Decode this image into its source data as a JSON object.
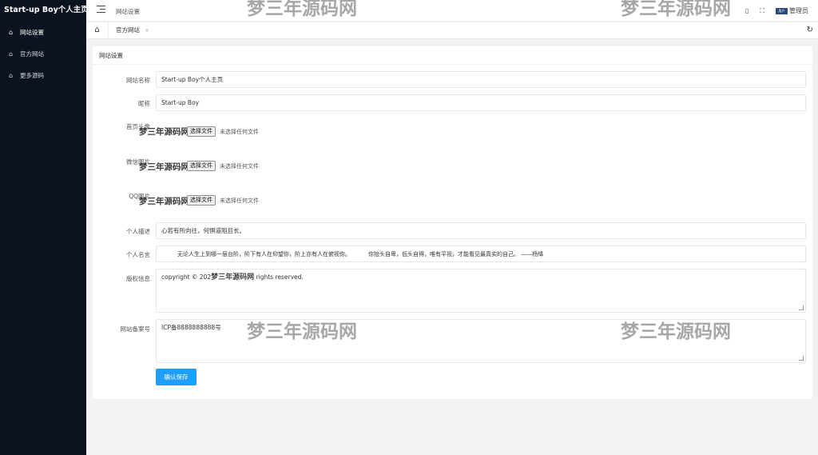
{
  "sidebar": {
    "logo": "Start-up Boy个人主页",
    "items": [
      {
        "label": "网站设置",
        "icon": "home-icon"
      },
      {
        "label": "官方网站",
        "icon": "home-icon"
      },
      {
        "label": "更多源码",
        "icon": "home-icon"
      }
    ]
  },
  "header": {
    "breadcrumb": "网站设置",
    "user_label": "管理员",
    "avatar_text": "用户"
  },
  "tabs": [
    {
      "label": "官方网站",
      "close": "×"
    }
  ],
  "form": {
    "card_title": "网站设置",
    "site_name_label": "网站名称",
    "site_name_value": "Start-up Boy个人主页",
    "nickname_label": "昵称",
    "nickname_value": "Start-up Boy",
    "avatar_label": "首页头像",
    "wechat_label": "微信图片",
    "qq_label": "QQ图片",
    "file_button": "选择文件",
    "file_status": "未选择任何文件",
    "desc_label": "个人描述",
    "desc_value": "心若有所向往，何惧道阻且长。",
    "motto_label": "个人名言",
    "motto_part1": "无论人生上到哪一层台阶，阶下有人在仰望你，阶上亦有人在俯视你。",
    "motto_part2": "你抬头自卑，低头自得，唯有平视，才能看见最真实的自己。 ——杨绛",
    "copyright_label": "版权信息",
    "copyright_prefix": "copyright © 202",
    "copyright_suffix": " rights reserved.",
    "icp_label": "网站备案号",
    "icp_value": "ICP备8888888888号",
    "submit_label": "确认保存"
  },
  "watermark": "梦三年源码网"
}
